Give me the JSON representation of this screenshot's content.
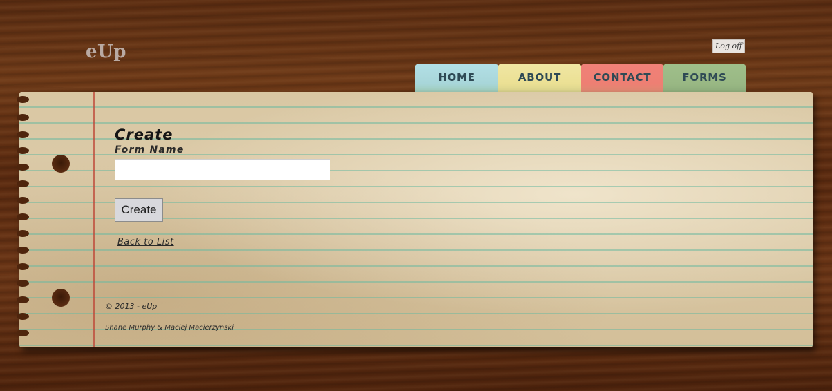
{
  "header": {
    "logo": "eUp",
    "logoff_label": "Log off"
  },
  "nav": {
    "tabs": [
      {
        "label": "HOME",
        "color": "#b2dfe6"
      },
      {
        "label": "ABOUT",
        "color": "#f0e6a3"
      },
      {
        "label": "CONTACT",
        "color": "#f08178"
      },
      {
        "label": "FORMS",
        "color": "#9fbf8a"
      }
    ]
  },
  "form": {
    "title": "Create",
    "field_label": "Form Name",
    "field_value": "",
    "submit_label": "Create",
    "back_link": "Back to List"
  },
  "footer": {
    "copyright": "© 2013 - eUp",
    "authors": "Shane Murphy & Maciej Macierzynski"
  }
}
